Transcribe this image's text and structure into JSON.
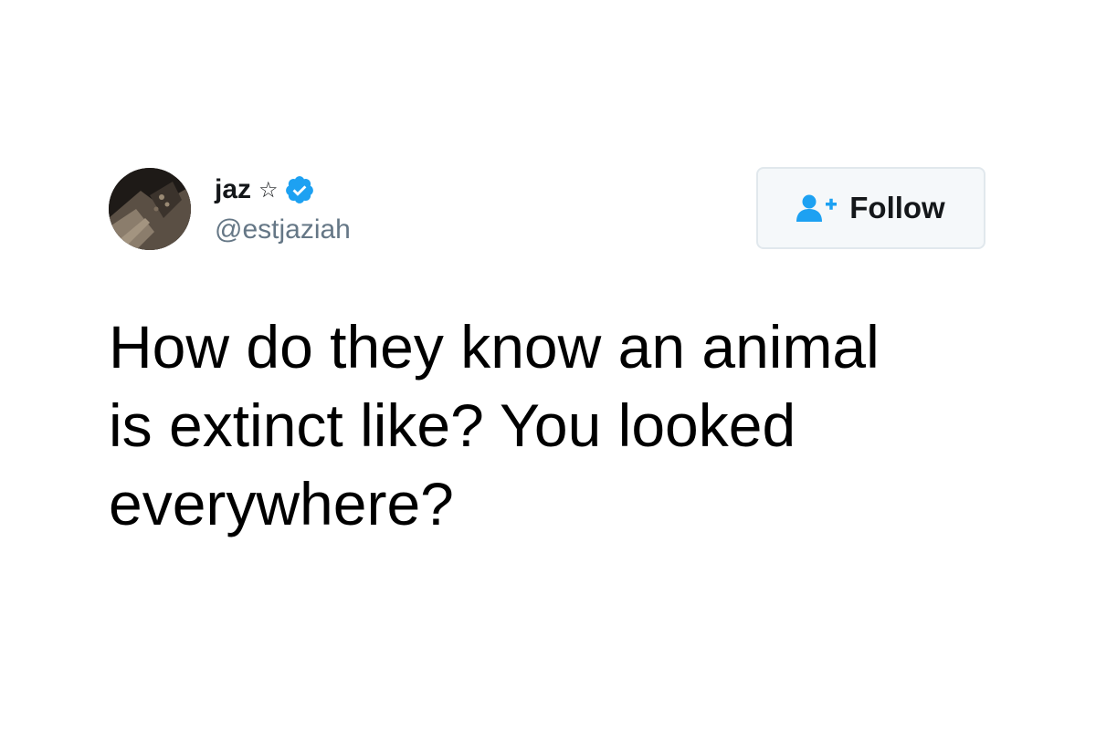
{
  "tweet": {
    "author": {
      "display_name": "jaz",
      "name_emoji": "☆",
      "handle": "@estjaziah",
      "verified": true
    },
    "follow_button": {
      "label": "Follow",
      "icon": "add-user-icon"
    },
    "text": "How do they know an animal\nis extinct like? You looked\neverywhere?"
  },
  "colors": {
    "text_primary": "#14171a",
    "text_secondary": "#657786",
    "verified_blue": "#1da1f2",
    "button_background": "#f5f8fa",
    "button_border": "#e1e8ed"
  }
}
